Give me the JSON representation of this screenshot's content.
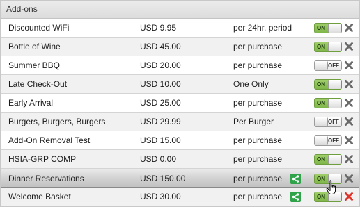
{
  "header": {
    "title": "Add-ons"
  },
  "colors": {
    "toggle_on": "#8cc152",
    "delete_gray": "#6a6a6a",
    "delete_red": "#e0332a",
    "share_green": "#2fa24a"
  },
  "addons": [
    {
      "name": "Discounted WiFi",
      "price": "USD 9.95",
      "term": "per 24hr. period",
      "toggle": "ON",
      "share": false,
      "delete_icon": "x-icon"
    },
    {
      "name": "Bottle of Wine",
      "price": "USD 45.00",
      "term": "per purchase",
      "toggle": "ON",
      "share": false,
      "delete_icon": "x-icon"
    },
    {
      "name": "Summer BBQ",
      "price": "USD 20.00",
      "term": "per purchase",
      "toggle": "OFF",
      "share": false,
      "delete_icon": "x-icon"
    },
    {
      "name": "Late Check-Out",
      "price": "USD 10.00",
      "term": "One Only",
      "toggle": "ON",
      "share": false,
      "delete_icon": "x-icon"
    },
    {
      "name": "Early Arrival",
      "price": "USD 25.00",
      "term": "per purchase",
      "toggle": "ON",
      "share": false,
      "delete_icon": "x-icon"
    },
    {
      "name": "Burgers, Burgers, Burgers",
      "price": "USD 29.99",
      "term": "Per Burger",
      "toggle": "OFF",
      "share": false,
      "delete_icon": "x-icon"
    },
    {
      "name": "Add-On Removal Test",
      "price": "USD 15.00",
      "term": "per purchase",
      "toggle": "OFF",
      "share": false,
      "delete_icon": "x-icon"
    },
    {
      "name": "HSIA-GRP COMP",
      "price": "USD 0.00",
      "term": "per purchase",
      "toggle": "ON",
      "share": false,
      "delete_icon": "x-icon"
    },
    {
      "name": "Dinner Reservations",
      "price": "USD 150.00",
      "term": "per purchase",
      "toggle": "ON",
      "share": true,
      "delete_icon": "x-icon",
      "hovered": true
    },
    {
      "name": "Welcome Basket",
      "price": "USD 30.00",
      "term": "per purchase",
      "toggle": "ON",
      "share": true,
      "delete_icon": "x-icon-red"
    }
  ]
}
